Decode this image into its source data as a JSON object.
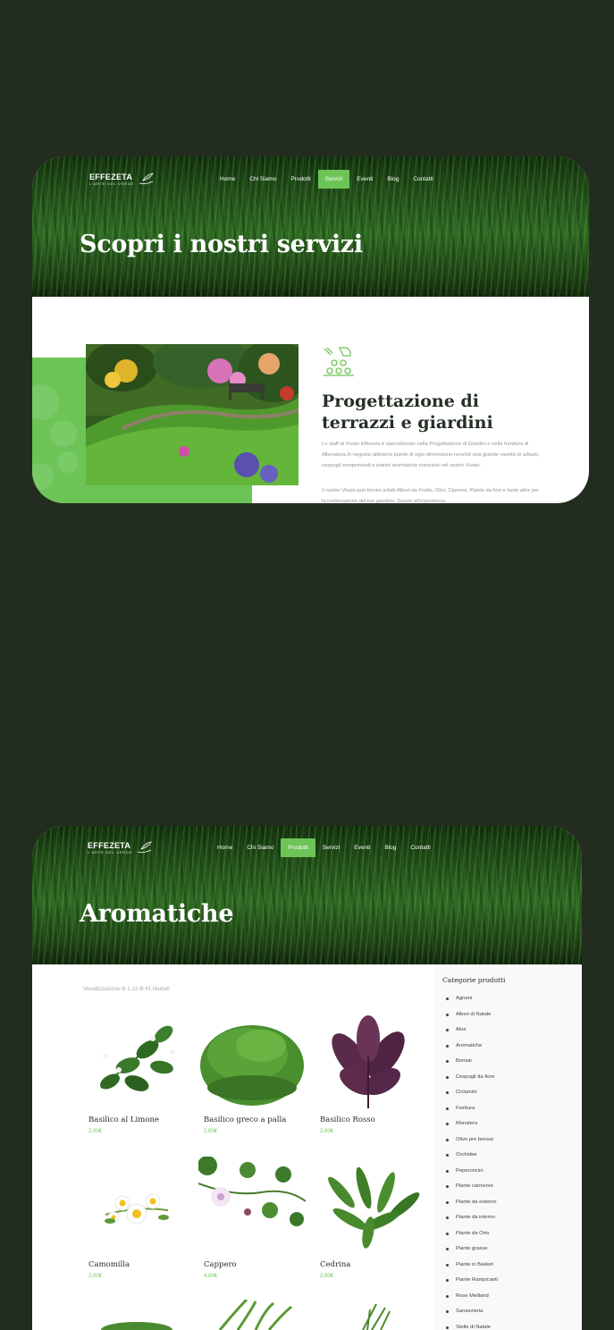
{
  "logo": {
    "name": "EFFEZETA",
    "tagline": "L'ARTE DEL VERDE"
  },
  "page1": {
    "nav": [
      "Home",
      "Chi Siamo",
      "Prodotti",
      "Servizi",
      "Eventi",
      "Blog",
      "Contatti"
    ],
    "active_nav": "Servizi",
    "hero_title": "Scopri i nostri servizi",
    "feature": {
      "icon": "gardening-plan-icon",
      "title": "Progettazione di terrazzi e giardini",
      "paragraph1": "Lo staff di Vivaio Effezeta è specializzato nella Progettazione di Giardini e nella fornitura di Alberatura.In negozio abbiamo piante di ogni dimensione nonché una grande varietà di arbusti, cespugli sempreverdi e piante aromatiche cresciute nel nostro Vivaio.",
      "paragraph2": "Il nostro Vivaio può fornire infatti Alberi da Frutto, Olivi, Cipressi, Piante da fiori e tante altre per la realizzazione del tuo giardino. Grazie all'esperienza"
    }
  },
  "page2": {
    "nav": [
      "Home",
      "Chi Siamo",
      "Prodotti",
      "Servizi",
      "Eventi",
      "Blog",
      "Contatti"
    ],
    "active_nav": "Prodotti",
    "hero_title": "Aromatiche",
    "result_count": "Visualizzazione di 1-12 di 41 risultati",
    "products": [
      {
        "name": "Basilico al Limone",
        "price": "2,00€",
        "icon": "basil-lemon-plant-icon"
      },
      {
        "name": "Basilico greco a palla",
        "price": "2,00€",
        "icon": "basil-bush-icon"
      },
      {
        "name": "Basilico Rosso",
        "price": "2,00€",
        "icon": "red-basil-icon"
      },
      {
        "name": "Camomilla",
        "price": "2,00€",
        "icon": "chamomile-icon"
      },
      {
        "name": "Cappero",
        "price": "4,00€",
        "icon": "caper-plant-icon"
      },
      {
        "name": "Cedrina",
        "price": "2,00€",
        "icon": "lemon-verbena-icon"
      }
    ],
    "sidebar": {
      "title": "Categorie prodotti",
      "categories": [
        "Agrumi",
        "Alberi di Natale",
        "Aloe",
        "Aromatiche",
        "Bonsai",
        "Cespugli da fiore",
        "Ciclamini",
        "Fioritura",
        "Monstera",
        "Olivo pre bonsai",
        "Orchidee",
        "Peperoncini",
        "Piante carnivore",
        "Piante da esterno",
        "Piante da interno",
        "Piante da Orto",
        "Piante grasse",
        "Piante in Basket",
        "Piante Rampicanti",
        "Rose Meilland",
        "Sansevieria",
        "Stelle di Natale"
      ]
    }
  },
  "colors": {
    "accent": "#6cc457",
    "background": "#222c1f",
    "heading": "#253025"
  }
}
